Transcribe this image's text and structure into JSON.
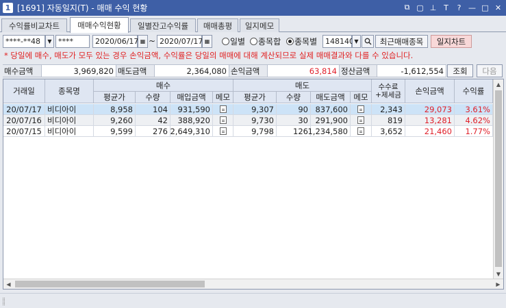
{
  "window": {
    "number": "1",
    "title": "[1691] 자동일지(T) - 매매 수익 현황",
    "controls": [
      "⧉",
      "▢",
      "⊥",
      "T",
      "?",
      "—",
      "□",
      "✕"
    ]
  },
  "tabs": [
    {
      "label": "수익률비교차트",
      "active": false
    },
    {
      "label": "매매수익현황",
      "active": true
    },
    {
      "label": "일별잔고수익률",
      "active": false
    },
    {
      "label": "매매총평",
      "active": false
    },
    {
      "label": "일지메모",
      "active": false
    }
  ],
  "toolbar": {
    "account": "****-**48",
    "password": "****",
    "start_date": "2020/06/17",
    "tilde": "~",
    "end_date": "2020/07/17",
    "radio_daily": "일별",
    "radio_stock_sum": "종목합",
    "radio_by_stock": "종목별",
    "selected_radio": "by_stock",
    "stock_code": "148140",
    "recent_button": "최근매매종목",
    "chart_button": "일지차트"
  },
  "notice": "* 당일에 매수, 매도가 모두 있는 경우 손익금액, 수익률은 당일의 매매에 대해 계산되므로 실제 매매결과와 다를 수 있습니다.",
  "summary": {
    "buy_label": "매수금액",
    "buy_value": "3,969,820",
    "sell_label": "매도금액",
    "sell_value": "2,364,080",
    "pl_label": "손익금액",
    "pl_value": "63,814",
    "settle_label": "정산금액",
    "settle_value": "-1,612,554",
    "query_button": "조회",
    "next_button": "다음"
  },
  "table": {
    "headers": {
      "date": "거래일",
      "stock": "종목명",
      "buy": "매수",
      "sell": "매도",
      "fee": "수수료\n+제세금",
      "pl": "손익금액",
      "rate": "수익률",
      "avg": "평균가",
      "qty": "수량",
      "buy_amount": "매입금액",
      "memo": "메모",
      "sell_amount": "매도금액"
    },
    "rows": [
      {
        "date": "20/07/17",
        "stock": "비디아이",
        "buy_avg": "8,958",
        "buy_qty": "104",
        "buy_amount": "931,590",
        "sell_avg": "9,307",
        "sell_qty": "90",
        "sell_amount": "837,600",
        "fee": "2,343",
        "pl": "29,073",
        "rate": "3.61%",
        "selected": true
      },
      {
        "date": "20/07/16",
        "stock": "비디아이",
        "buy_avg": "9,260",
        "buy_qty": "42",
        "buy_amount": "388,920",
        "sell_avg": "9,730",
        "sell_qty": "30",
        "sell_amount": "291,900",
        "fee": "819",
        "pl": "13,281",
        "rate": "4.62%",
        "selected": false
      },
      {
        "date": "20/07/15",
        "stock": "비디아이",
        "buy_avg": "9,599",
        "buy_qty": "276",
        "buy_amount": "2,649,310",
        "sell_avg": "9,798",
        "sell_qty": "126",
        "sell_amount": "1,234,580",
        "fee": "3,652",
        "pl": "21,460",
        "rate": "1.77%",
        "selected": false
      }
    ]
  },
  "colors": {
    "title_bar": "#3e5fa6",
    "header_bg": "#dfe6f2",
    "selected_row": "#cde3f7",
    "alt_row": "#eef0f3",
    "profit_red": "#e0202a",
    "notice_red": "#e02020",
    "chart_button_bg": "#f8d8d8"
  },
  "icons": {
    "dropdown": "chevron-down-icon",
    "calendar": "calendar-icon",
    "search": "search-icon",
    "memo": "memo-icon"
  }
}
